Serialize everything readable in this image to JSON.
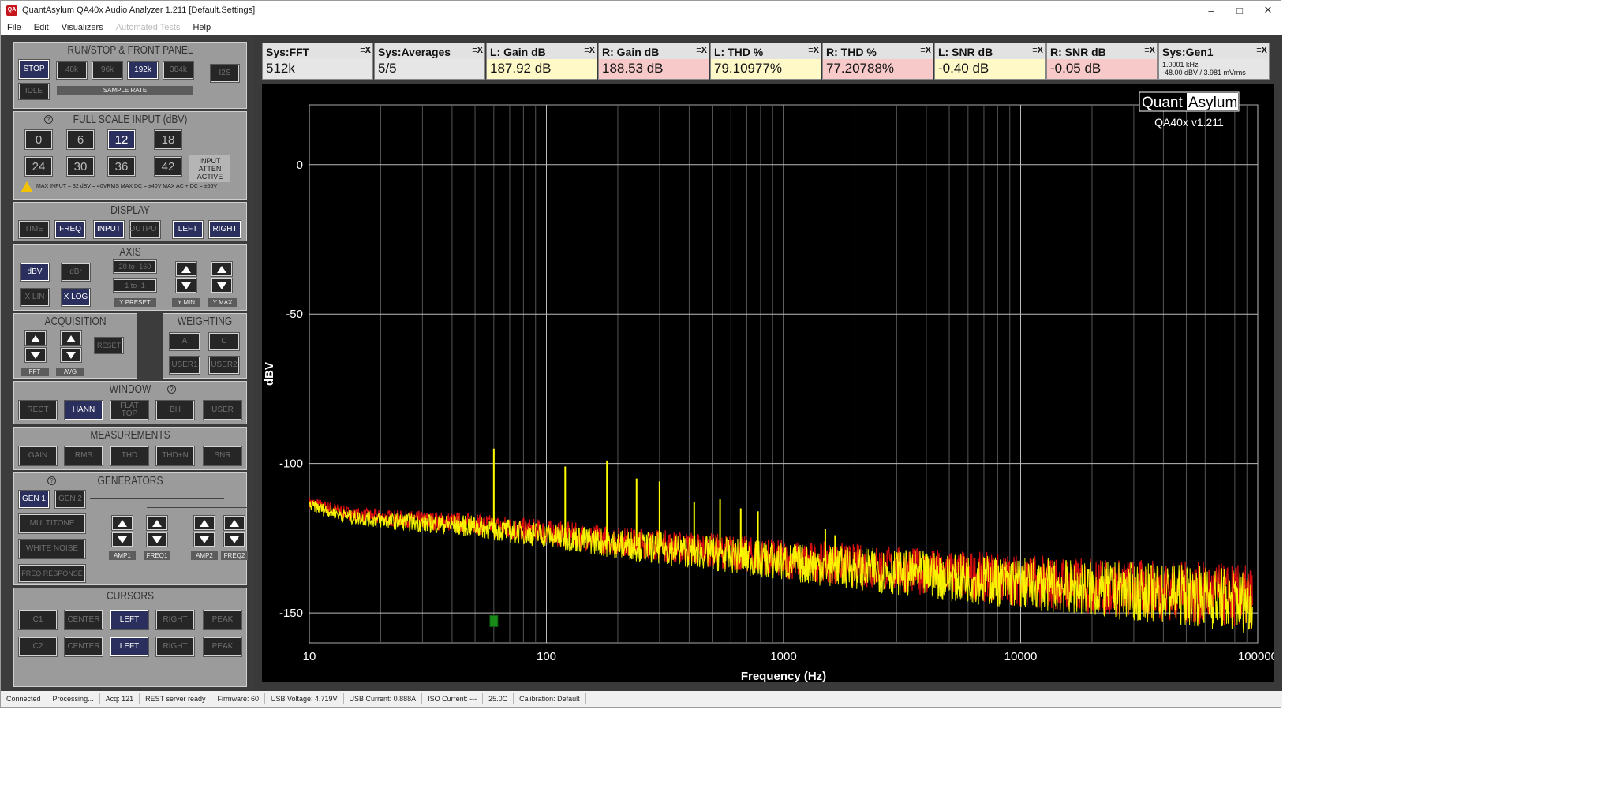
{
  "window": {
    "title": "QuantAsylum QA40x Audio Analyzer 1.211 [Default.Settings]",
    "icon_text": "QA"
  },
  "menu": [
    "File",
    "Edit",
    "Visualizers",
    "Automated Tests",
    "Help"
  ],
  "panels": {
    "run": {
      "title": "RUN/STOP & FRONT PANEL",
      "stop": "STOP",
      "idle": "IDLE",
      "rates": [
        "48k",
        "96k",
        "192k",
        "384k"
      ],
      "selected_rate": "192k",
      "i2s": "I2S",
      "rate_label": "SAMPLE RATE"
    },
    "fullscale": {
      "title": "FULL SCALE INPUT (dBV)",
      "values": [
        "0",
        "6",
        "12",
        "18",
        "24",
        "30",
        "36",
        "42"
      ],
      "selected": "12",
      "atten": "INPUT ATTEN ACTIVE",
      "warning": "MAX INPUT = 32 dBV = 40VRMS    MAX DC = ±40V    MAX AC + DC = ±56V"
    },
    "display": {
      "title": "DISPLAY",
      "buttons": [
        "TIME",
        "FREQ",
        "INPUT",
        "OUTPUT",
        "LEFT",
        "RIGHT"
      ]
    },
    "axis": {
      "title": "AXIS",
      "dbv": "dBV",
      "dbr": "dBr",
      "xlin": "X LIN",
      "xlog": "X LOG",
      "preset1": "20 to -160",
      "preset2": "1 to -1",
      "ypreset": "Y PRESET",
      "ymin": "Y MIN",
      "ymax": "Y MAX"
    },
    "acquisition": {
      "title": "ACQUISITION",
      "reset": "RESET",
      "fft": "FFT",
      "avg": "AVG"
    },
    "weighting": {
      "title": "WEIGHTING",
      "a": "A",
      "c": "C",
      "user1": "USER1",
      "user2": "USER2"
    },
    "window": {
      "title": "WINDOW",
      "buttons": [
        "RECT",
        "HANN",
        "FLAT TOP",
        "BH",
        "USER"
      ]
    },
    "measurements": {
      "title": "MEASUREMENTS",
      "buttons": [
        "GAIN",
        "RMS",
        "THD",
        "THD+N",
        "SNR"
      ]
    },
    "generators": {
      "title": "GENERATORS",
      "gen1": "GEN 1",
      "gen2": "GEN 2",
      "multitone": "MULTITONE",
      "white_noise": "WHITE NOISE",
      "freq_response": "FREQ RESPONSE",
      "amp1": "AMP1",
      "freq1": "FREQ1",
      "amp2": "AMP2",
      "freq2": "FREQ2"
    },
    "cursors": {
      "title": "CURSORS",
      "row1": [
        "C1",
        "CENTER",
        "LEFT",
        "RIGHT",
        "PEAK"
      ],
      "row2": [
        "C2",
        "CENTER",
        "LEFT",
        "RIGHT",
        "PEAK"
      ]
    }
  },
  "measurements": [
    {
      "name": "Sys:FFT",
      "value": "512k",
      "color": "white"
    },
    {
      "name": "Sys:Averages",
      "value": "5/5",
      "color": "white"
    },
    {
      "name": "L: Gain dB",
      "value": "187.92 dB",
      "color": "yellow"
    },
    {
      "name": "R: Gain dB",
      "value": "188.53 dB",
      "color": "pink"
    },
    {
      "name": "L: THD %",
      "value": "79.10977%",
      "color": "yellow"
    },
    {
      "name": "R: THD %",
      "value": "77.20788%",
      "color": "pink"
    },
    {
      "name": "L: SNR dB",
      "value": "-0.40 dB",
      "color": "yellow"
    },
    {
      "name": "R: SNR dB",
      "value": "-0.05 dB",
      "color": "pink"
    },
    {
      "name": "Sys:Gen1",
      "line1": "1.0001 kHz",
      "line2": "-48.00 dBV  / 3.981 mVrms",
      "color": "white"
    }
  ],
  "meas_controls": "≡X",
  "logo": {
    "quant": "Quant",
    "asylum": "Asylum",
    "version": "QA40x v1.211"
  },
  "chart_data": {
    "type": "line",
    "xlabel": "Frequency (Hz)",
    "ylabel": "dBV",
    "xscale": "log",
    "xlim": [
      10,
      100000
    ],
    "ylim": [
      -160,
      20
    ],
    "xticks": [
      10,
      100,
      1000,
      10000,
      100000
    ],
    "xtick_labels": [
      "10",
      "100",
      "1000",
      "10000",
      "100000"
    ],
    "yticks": [
      0,
      -50,
      -100,
      -150
    ],
    "ytick_labels": [
      "0",
      "-50",
      "-100",
      "-150"
    ],
    "grid": true,
    "series": [
      {
        "channel": "right",
        "color": "#e01010",
        "x": [
          10,
          15,
          20,
          30,
          50,
          60,
          100,
          200,
          500,
          1000,
          2000,
          5000,
          10000,
          20000,
          50000,
          95000
        ],
        "y": [
          -113,
          -117,
          -118,
          -119,
          -120,
          -121,
          -123,
          -126,
          -129,
          -132,
          -134,
          -137,
          -139,
          -141,
          -143,
          -145
        ]
      },
      {
        "channel": "left",
        "color": "#ffff00",
        "x": [
          10,
          15,
          20,
          30,
          50,
          60,
          100,
          200,
          500,
          1000,
          2000,
          5000,
          10000,
          20000,
          50000,
          95000
        ],
        "y": [
          -114,
          -118,
          -119,
          -120,
          -121,
          -122,
          -124,
          -127,
          -130,
          -133,
          -135,
          -138,
          -140,
          -142,
          -144,
          -146
        ]
      }
    ],
    "peaks": [
      {
        "x": 60,
        "y": -95
      },
      {
        "x": 120,
        "y": -101
      },
      {
        "x": 180,
        "y": -99
      },
      {
        "x": 240,
        "y": -105
      },
      {
        "x": 300,
        "y": -106
      },
      {
        "x": 420,
        "y": -113
      },
      {
        "x": 540,
        "y": -112
      },
      {
        "x": 660,
        "y": -115
      },
      {
        "x": 780,
        "y": -116
      },
      {
        "x": 1500,
        "y": -122
      },
      {
        "x": 1650,
        "y": -124
      }
    ],
    "marker": {
      "x": 60,
      "y": -153,
      "color": "#1a8a1a"
    }
  },
  "status": [
    "Connected",
    "Processing...",
    "Acq: 121",
    "REST server ready",
    "Firmware: 60",
    "USB Voltage: 4.719V",
    "USB Current: 0.888A",
    "ISO Current: ---",
    "25.0C",
    "Calibration: Default"
  ]
}
